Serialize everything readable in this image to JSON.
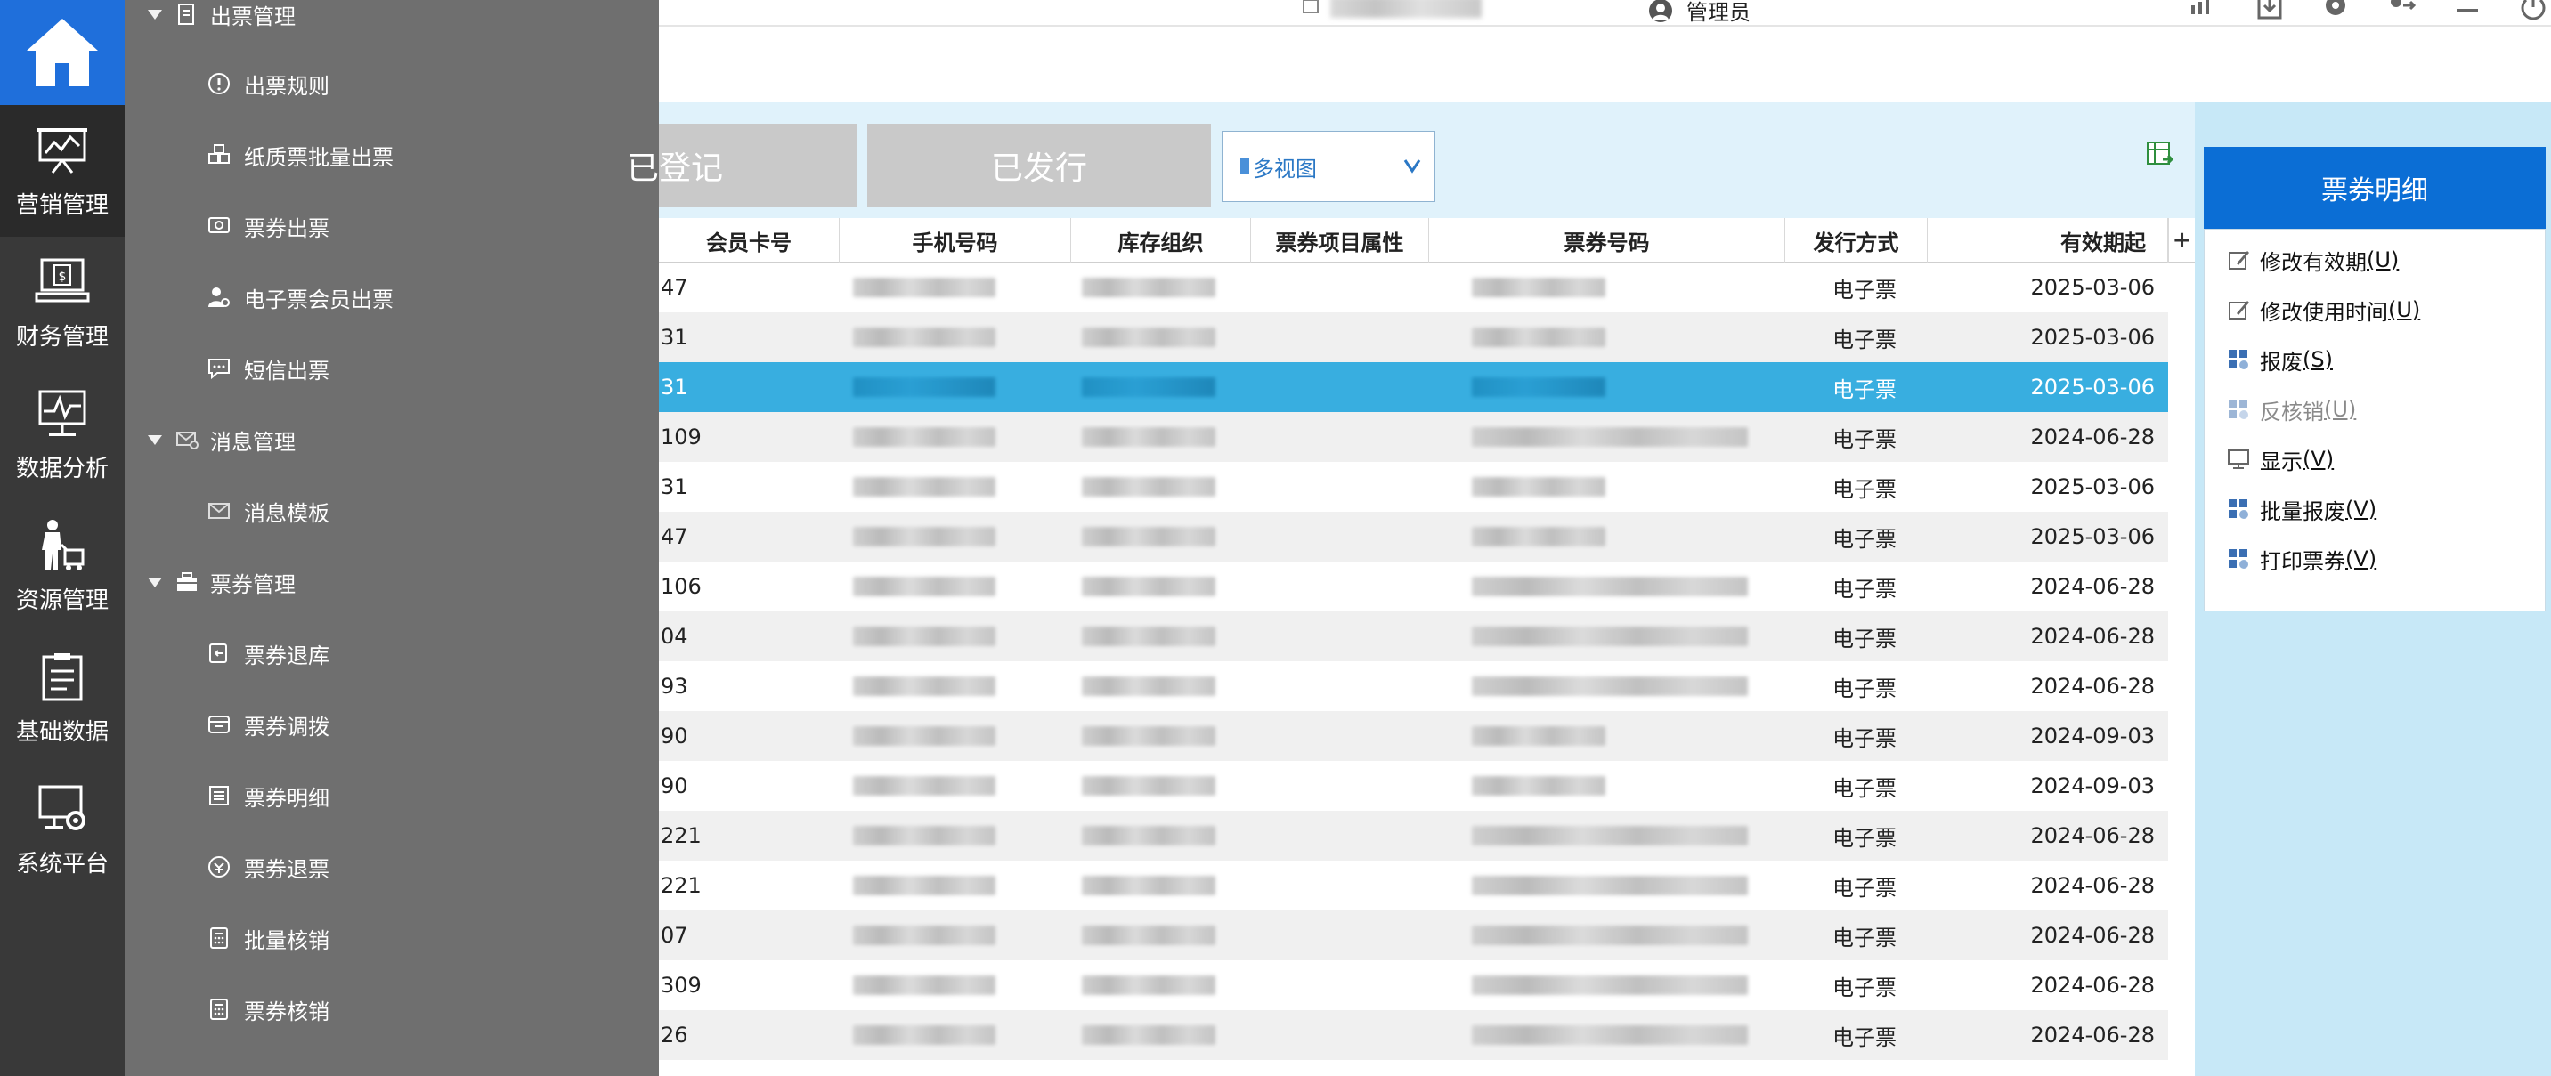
{
  "rail": {
    "items": [
      {
        "label": "营销管理",
        "icon": "presentation-chart-icon"
      },
      {
        "label": "财务管理",
        "icon": "finance-monitor-icon"
      },
      {
        "label": "数据分析",
        "icon": "analytics-monitor-icon"
      },
      {
        "label": "资源管理",
        "icon": "person-cart-icon"
      },
      {
        "label": "基础数据",
        "icon": "clipboard-icon"
      },
      {
        "label": "系统平台",
        "icon": "monitor-gear-icon"
      }
    ]
  },
  "menu": {
    "group1": "出票管理",
    "g1_items": [
      "出票规则",
      "纸质票批量出票",
      "票券出票",
      "电子票会员出票",
      "短信出票"
    ],
    "group2": "消息管理",
    "g2_items": [
      "消息模板"
    ],
    "group3": "票券管理",
    "g3_items": [
      "票券退库",
      "票券调拨",
      "票券明细",
      "票券退票",
      "批量核销",
      "票券核销"
    ]
  },
  "topbar": {
    "user_role": "管理员"
  },
  "toolbar": {
    "tab_registered": "已登记",
    "tab_issued": "已发行",
    "view_select": "多视图"
  },
  "table": {
    "columns": [
      "会员卡号",
      "手机号码",
      "库存组织",
      "票券项目属性",
      "票券号码",
      "发行方式",
      "有效期起"
    ],
    "rows": [
      {
        "card": "47",
        "mode": "电子票",
        "date": "2025-03-06"
      },
      {
        "card": "31",
        "mode": "电子票",
        "date": "2025-03-06"
      },
      {
        "card": "31",
        "mode": "电子票",
        "date": "2025-03-06"
      },
      {
        "card": "109",
        "mode": "电子票",
        "date": "2024-06-28"
      },
      {
        "card": "31",
        "mode": "电子票",
        "date": "2025-03-06"
      },
      {
        "card": "47",
        "mode": "电子票",
        "date": "2025-03-06"
      },
      {
        "card": "106",
        "mode": "电子票",
        "date": "2024-06-28"
      },
      {
        "card": "04",
        "mode": "电子票",
        "date": "2024-06-28"
      },
      {
        "card": "93",
        "mode": "电子票",
        "date": "2024-06-28"
      },
      {
        "card": "90",
        "mode": "电子票",
        "date": "2024-09-03"
      },
      {
        "card": "90",
        "mode": "电子票",
        "date": "2024-09-03"
      },
      {
        "card": "221",
        "mode": "电子票",
        "date": "2024-06-28"
      },
      {
        "card": "221",
        "mode": "电子票",
        "date": "2024-06-28"
      },
      {
        "card": "07",
        "mode": "电子票",
        "date": "2024-06-28"
      },
      {
        "card": "309",
        "mode": "电子票",
        "date": "2024-06-28"
      },
      {
        "card": "26",
        "mode": "电子票",
        "date": "2024-06-28"
      }
    ]
  },
  "panel": {
    "title": "票券明细",
    "actions": [
      {
        "label": "修改有效期",
        "key": "(U)"
      },
      {
        "label": "修改使用时间",
        "key": "(U)"
      },
      {
        "label": "报废",
        "key": "(S)"
      },
      {
        "label": "反核销",
        "key": "(U)"
      },
      {
        "label": "显示",
        "key": "(V)"
      },
      {
        "label": "批量报废",
        "key": "(V)"
      },
      {
        "label": "打印票券",
        "key": "(V)"
      }
    ]
  },
  "colors": {
    "accent": "#0b6ed5",
    "selected_row": "#38aee0",
    "rail_bg": "#393939",
    "flyout_bg": "#6f6f6f"
  }
}
